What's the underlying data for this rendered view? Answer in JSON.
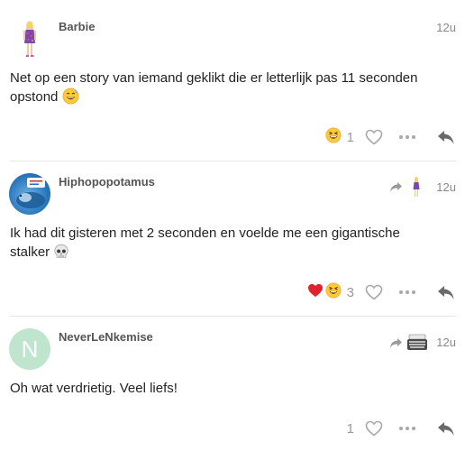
{
  "posts": [
    {
      "username": "Barbie",
      "time": "12u",
      "body": "Net op een story van iemand geklikt die er letterlijk pas 11 seconden opstond",
      "body_emoji": "sweat-smile",
      "reactions": [
        "grinning-squint"
      ],
      "like_count": "1",
      "avatar": "barbie-doll"
    },
    {
      "username": "Hiphopopotamus",
      "time": "12u",
      "body": "Ik had dit gisteren met 2 seconden en voelde me een gigantische stalker",
      "body_emoji": "skull",
      "reactions": [
        "heart",
        "grinning-squint"
      ],
      "like_count": "3",
      "avatar": "hippo-photo",
      "reply_to_avatar": "barbie-doll"
    },
    {
      "username": "NeverLeNkemise",
      "time": "12u",
      "body": "Oh wat verdrietig. Veel liefs!",
      "reactions": [],
      "like_count": "1",
      "avatar_letter": "N",
      "avatar_color": "#bfe5cf",
      "reply_to_avatar": "typewriter"
    }
  ],
  "colors": {
    "text": "#222222",
    "username": "#555555",
    "meta": "#888888",
    "icon": "#999999",
    "divider": "#e6e6e6"
  }
}
